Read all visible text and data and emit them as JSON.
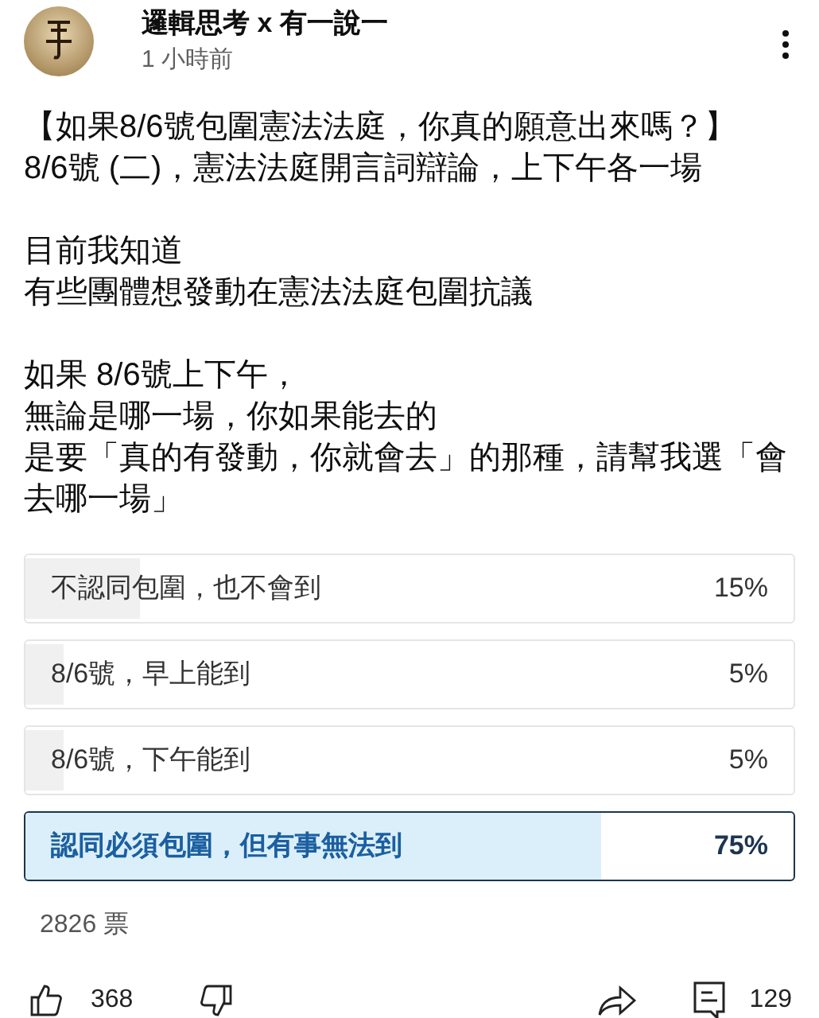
{
  "header": {
    "author": "邏輯思考 x 有一說一",
    "time": "1 小時前"
  },
  "post": {
    "paragraphs": [
      [
        "【如果8/6號包圍憲法法庭，你真的願意出來嗎？】",
        "8/6號 (二)，憲法法庭開言詞辯論，上下午各一場"
      ],
      [
        "目前我知道",
        "有些團體想發動在憲法法庭包圍抗議"
      ],
      [
        "如果 8/6號上下午，",
        "無論是哪一場，你如果能去的",
        "是要「真的有發動，你就會去」的那種，請幫我選「會",
        "去哪一場」"
      ]
    ]
  },
  "poll": {
    "options": [
      {
        "label": "不認同包圍，也不會到",
        "percent": "15%",
        "level": 0.15,
        "selected": false
      },
      {
        "label": "8/6號，早上能到",
        "percent": "5%",
        "level": 0.05,
        "selected": false
      },
      {
        "label": "8/6號，下午能到",
        "percent": "5%",
        "level": 0.05,
        "selected": false
      },
      {
        "label": "認同必須包圍，但有事無法到",
        "percent": "75%",
        "level": 0.75,
        "selected": true
      }
    ],
    "votes": "2826 票"
  },
  "actions": {
    "likes": "368",
    "comments": "129"
  }
}
